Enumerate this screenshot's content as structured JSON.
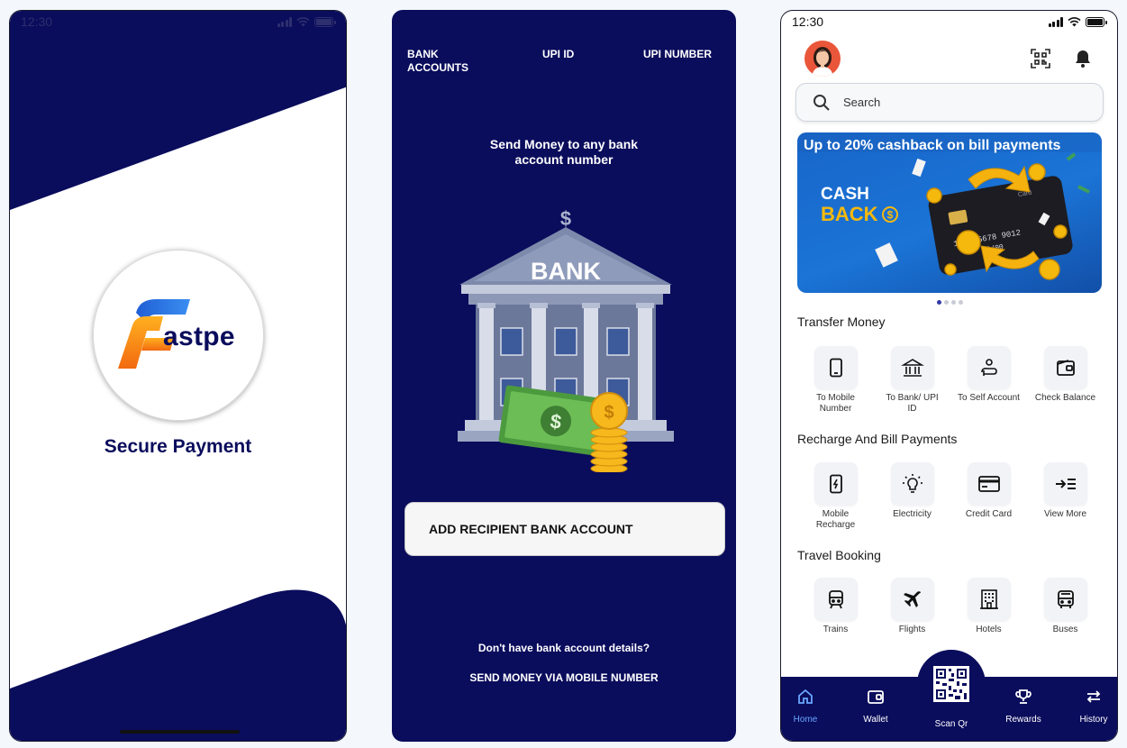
{
  "status_time": "12:30",
  "splash": {
    "brand_letter": "F",
    "brand_rest": "astpe",
    "slogan": "Secure Payment"
  },
  "bank_screen": {
    "tabs": [
      "BANK ACCOUNTS",
      "UPI ID",
      "UPI NUMBER"
    ],
    "title_line1": "Send  Money to any bank",
    "title_line2": "account number",
    "bank_sign": "BANK",
    "currency_symbol": "$",
    "add_button": "ADD RECIPIENT BANK ACCOUNT",
    "question": "Don't have bank account details?",
    "mobile_link": "SEND MONEY VIA MOBILE NUMBER"
  },
  "home": {
    "search_placeholder": "Search",
    "banner": {
      "headline": "Up to 20% cashback on bill payments",
      "cash": "CASH",
      "back": "BACK",
      "card_number": "1234 5678 9012",
      "card_expiry": "00/00",
      "card_label": "Card",
      "slide_index": 1,
      "slide_count": 4
    },
    "sections": [
      {
        "title": "Transfer Money",
        "items": [
          {
            "label": "To Mobile Number",
            "icon": "mobile-icon"
          },
          {
            "label": "To  Bank/ UPI ID",
            "icon": "bank-icon"
          },
          {
            "label": "To  Self Account",
            "icon": "self-transfer-icon"
          },
          {
            "label": "Check Balance",
            "icon": "wallet-icon"
          }
        ]
      },
      {
        "title": "Recharge And Bill Payments",
        "items": [
          {
            "label": "Mobile Recharge",
            "icon": "mobile-recharge-icon"
          },
          {
            "label": "Electricity",
            "icon": "bulb-icon"
          },
          {
            "label": "Credit Card",
            "icon": "credit-card-icon"
          },
          {
            "label": "View More",
            "icon": "view-more-icon"
          }
        ]
      },
      {
        "title": "Travel Booking",
        "items": [
          {
            "label": "Trains",
            "icon": "train-icon"
          },
          {
            "label": "Flights",
            "icon": "plane-icon"
          },
          {
            "label": "Hotels",
            "icon": "hotel-icon"
          },
          {
            "label": "Buses",
            "icon": "bus-icon"
          }
        ]
      }
    ],
    "nav": [
      {
        "label": "Home",
        "icon": "home-icon",
        "active": true
      },
      {
        "label": "Wallet",
        "icon": "wallet-icon"
      },
      {
        "label": "Scan Qr",
        "icon": "qr-icon"
      },
      {
        "label": "Rewards",
        "icon": "trophy-icon"
      },
      {
        "label": "History",
        "icon": "history-icon"
      }
    ]
  },
  "colors": {
    "navy": "#0a0c5c",
    "accent_orange": "#f7931e",
    "accent_blue": "#2f6fe0",
    "active_nav": "#6aa7ff"
  }
}
